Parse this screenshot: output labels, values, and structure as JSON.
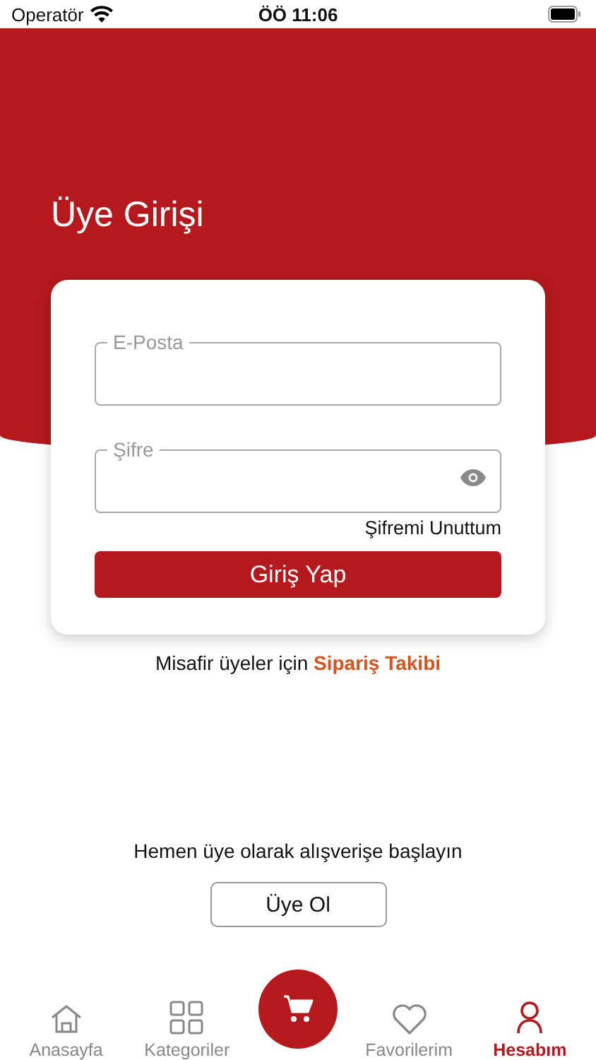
{
  "status_bar": {
    "carrier": "Operatör",
    "time": "ÖÖ 11:06"
  },
  "title": "Üye Girişi",
  "login_form": {
    "fields": [
      {
        "label": "E-Posta",
        "kind": "text"
      },
      {
        "label": "Şifre",
        "kind": "password"
      }
    ],
    "forgot_link": "Şifremi Unuttum",
    "submit_button": "Giriş Yap"
  },
  "guest": {
    "text": "Misafir üyeler için",
    "link": "Sipariş Takibi"
  },
  "register": {
    "prompt": "Hemen üye olarak alışverişe başlayın",
    "button": "Üye Ol"
  },
  "tab_bar": [
    {
      "kind": "home",
      "label": "Anasayfa",
      "selected": false
    },
    {
      "kind": "grid",
      "label": "Kategoriler",
      "selected": false
    },
    {
      "kind": "cart",
      "selected": false
    },
    {
      "kind": "heart",
      "label": "Favorilerim",
      "selected": false
    },
    {
      "kind": "user",
      "label": "Hesabım",
      "selected": true
    }
  ]
}
